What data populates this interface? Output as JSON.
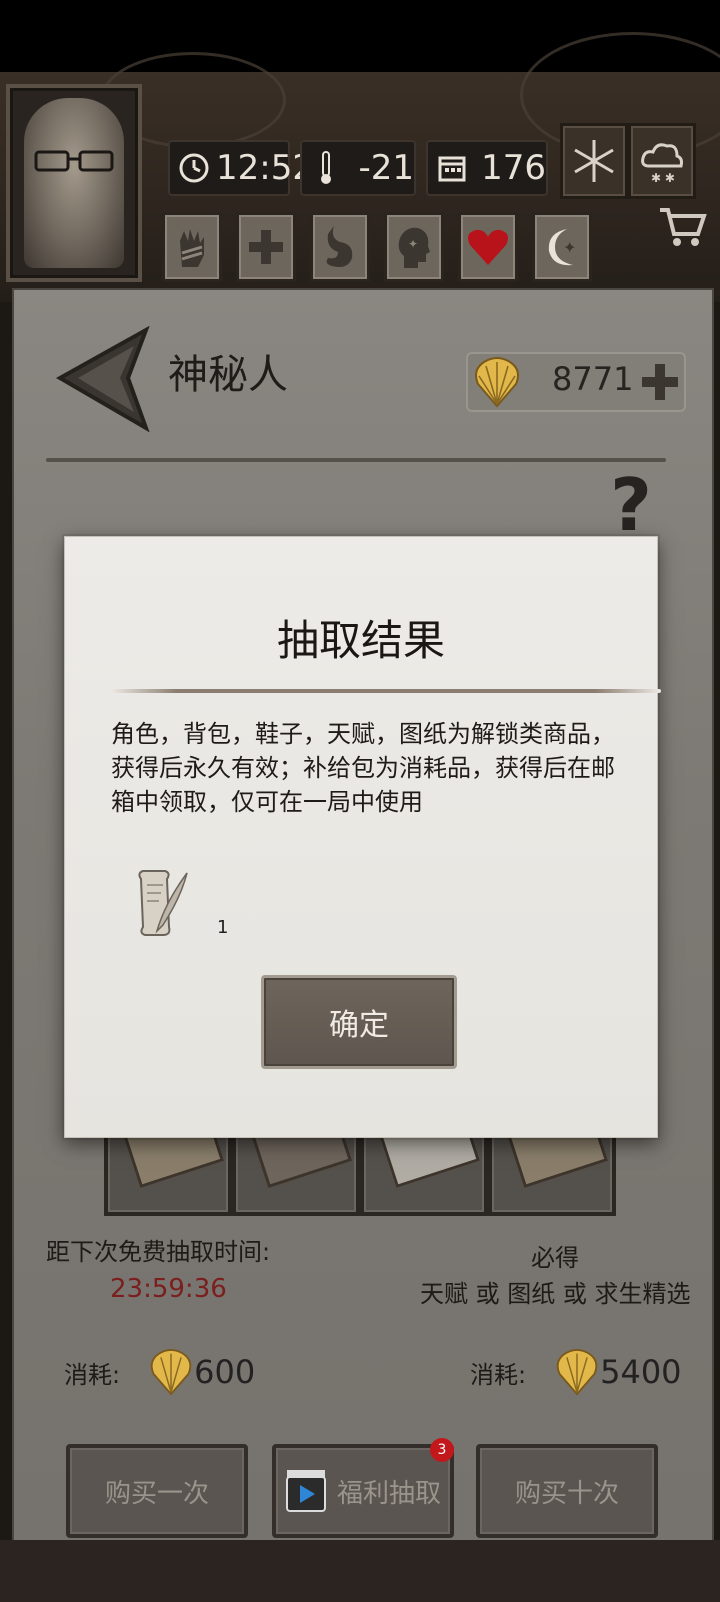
{
  "hud": {
    "time": "12:52",
    "temperature": "-21",
    "day": "176",
    "weather_icons": [
      "snowflake-icon",
      "snow-cloud-icon"
    ],
    "status_icons": [
      "bandaged-hand-icon",
      "medical-cross-icon",
      "stomach-icon",
      "head-icon",
      "heart-icon",
      "moon-star-icon"
    ]
  },
  "shop": {
    "title": "神秘人",
    "currency_amount": "8771",
    "help_symbol": "?"
  },
  "draw_info": {
    "free_timer_label": "距下次免费抽取时间:",
    "free_timer_value": "23:59:36",
    "guarantee_title": "必得",
    "guarantee_body": "天赋 或 图纸 或 求生精选",
    "cost_label": "消耗:",
    "cost_single": "600",
    "cost_ten": "5400"
  },
  "buttons": {
    "buy_once": "购买一次",
    "welfare_draw": "福利抽取",
    "welfare_badge": "3",
    "buy_ten": "购买十次"
  },
  "dialog": {
    "title": "抽取结果",
    "description": "角色，背包，鞋子，天赋，图纸为解锁类商品，获得后永久有效；补给包为消耗品，获得后在邮箱中领取，仅可在一局中使用",
    "item_icon": "scroll-quill-icon",
    "item_quantity": "1",
    "confirm": "确定"
  },
  "colors": {
    "panel": "#7d7974",
    "dialog_bg": "#e8e6e1",
    "timer": "#7a1e1e",
    "badge": "#c2181b"
  }
}
